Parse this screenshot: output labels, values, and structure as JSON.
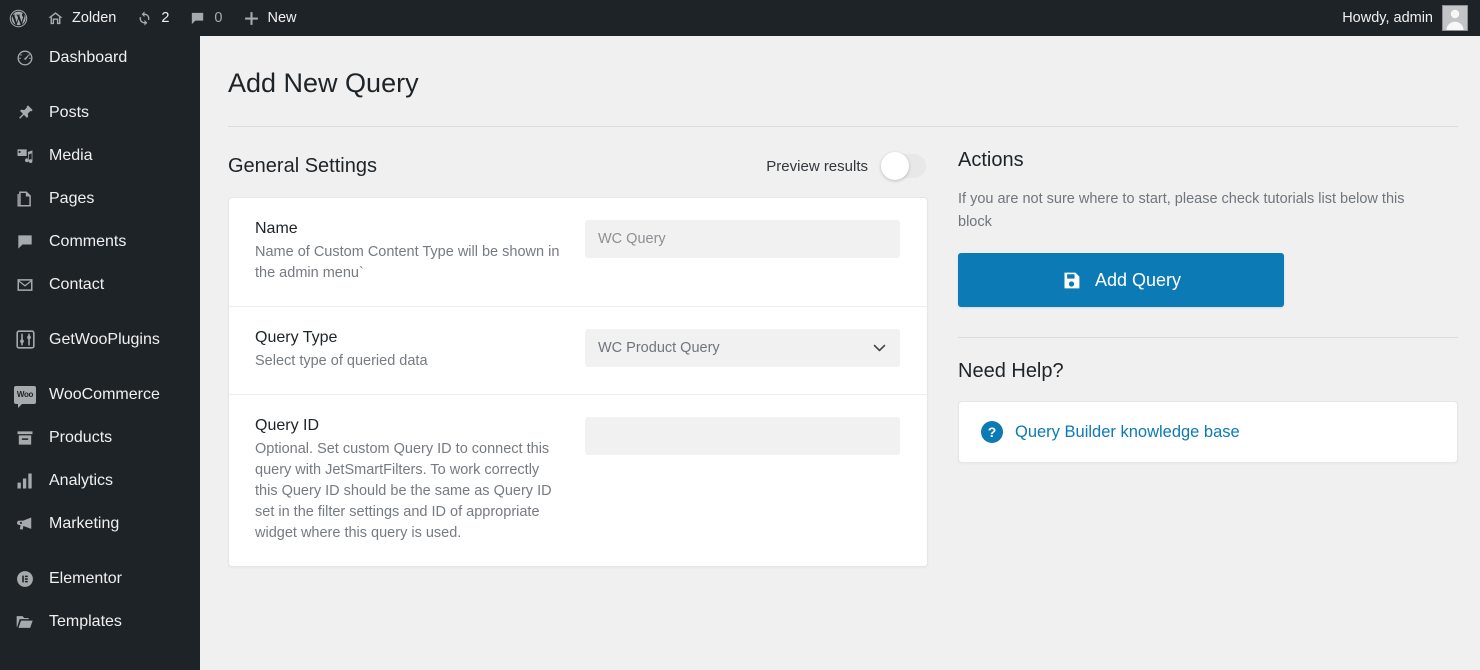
{
  "adminbar": {
    "wp_logo": "wordpress-logo",
    "site_name": "Zolden",
    "updates_count": "2",
    "comments_count": "0",
    "new_label": "New",
    "howdy": "Howdy, admin"
  },
  "sidebar": {
    "items": [
      {
        "label": "Dashboard",
        "icon": "dashboard-icon",
        "sep_after": true
      },
      {
        "label": "Posts",
        "icon": "pin-icon",
        "sep_after": false
      },
      {
        "label": "Media",
        "icon": "media-icon",
        "sep_after": false
      },
      {
        "label": "Pages",
        "icon": "pages-icon",
        "sep_after": false
      },
      {
        "label": "Comments",
        "icon": "comment-icon",
        "sep_after": false
      },
      {
        "label": "Contact",
        "icon": "envelope-icon",
        "sep_after": true
      },
      {
        "label": "GetWooPlugins",
        "icon": "sliders-icon",
        "sep_after": true
      },
      {
        "label": "WooCommerce",
        "icon": "woo-icon",
        "sep_after": false
      },
      {
        "label": "Products",
        "icon": "products-icon",
        "sep_after": false
      },
      {
        "label": "Analytics",
        "icon": "analytics-icon",
        "sep_after": false
      },
      {
        "label": "Marketing",
        "icon": "megaphone-icon",
        "sep_after": true
      },
      {
        "label": "Elementor",
        "icon": "elementor-icon",
        "sep_after": false
      },
      {
        "label": "Templates",
        "icon": "folder-icon",
        "sep_after": false
      }
    ]
  },
  "page": {
    "title": "Add New Query"
  },
  "general": {
    "section_title": "General Settings",
    "preview_label": "Preview results",
    "preview_enabled": false,
    "fields": [
      {
        "label": "Name",
        "desc": "Name of Custom Content Type will be shown in the admin menu`",
        "type": "text",
        "value": "",
        "placeholder": "WC Query"
      },
      {
        "label": "Query Type",
        "desc": "Select type of queried data",
        "type": "select",
        "value": "WC Product Query",
        "placeholder": ""
      },
      {
        "label": "Query ID",
        "desc": "Optional. Set custom Query ID to connect this query with JetSmartFilters. To work correctly this Query ID should be the same as Query ID set in the filter settings and ID of appropriate widget where this query is used.",
        "type": "text",
        "value": "",
        "placeholder": ""
      }
    ]
  },
  "actions": {
    "title": "Actions",
    "desc": "If you are not sure where to start, please check tutorials list below this block",
    "button_label": "Add Query",
    "button_icon": "save-icon",
    "button_color": "#0b7ab5"
  },
  "help": {
    "title": "Need Help?",
    "link_label": "Query Builder knowledge base",
    "link_icon": "question-circle-icon",
    "link_color": "#0b7ab5"
  }
}
